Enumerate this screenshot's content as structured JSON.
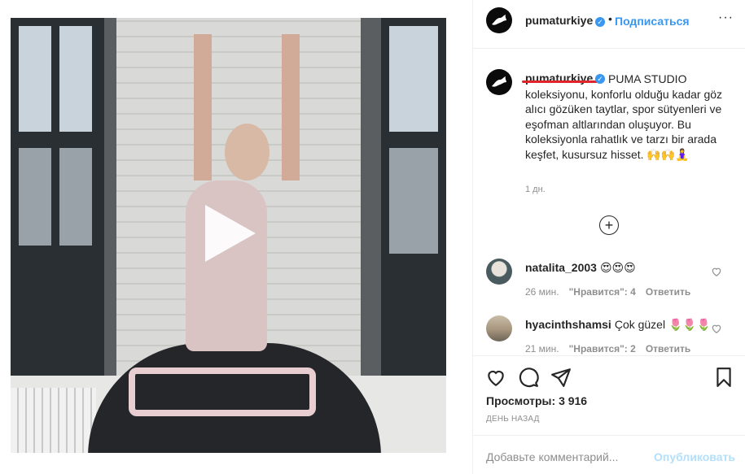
{
  "header": {
    "username": "pumaturkiye",
    "separator": "•",
    "follow_label": "Подписаться",
    "more_label": "···"
  },
  "caption": {
    "username": "pumaturkiye",
    "text": "PUMA STUDIO koleksiyonu, konforlu olduğu kadar göz alıcı gözüken taytlar, spor sütyenleri ve eşofman altlarından oluşuyor. Bu koleksiyonla rahatlık ve tarzı bir arada keşfet, kusursuz hisset. 🙌🙌🧘‍♀️",
    "time": "1 дн.",
    "load_more": "+"
  },
  "comments": [
    {
      "username": "natalita_2003",
      "text": "😍😍😍",
      "time": "26 мин.",
      "likes": "\"Нравится\": 4",
      "reply": "Ответить"
    },
    {
      "username": "hyacinthshamsi",
      "text": "Çok güzel 🌷🌷🌷",
      "time": "21 мин.",
      "likes": "\"Нравится\": 2",
      "reply": "Ответить"
    }
  ],
  "stats": {
    "views_label": "Просмотры:",
    "views_value": "3 916",
    "date": "ДЕНЬ НАЗАД"
  },
  "composer": {
    "placeholder": "Добавьте комментарий...",
    "publish_label": "Опубликовать"
  },
  "colors": {
    "accent": "#3897f0",
    "text": "#262626",
    "muted": "#8e8e8e",
    "highlight": "#e0242b"
  },
  "icons": [
    "puma-logo-icon",
    "verified-icon",
    "more-icon",
    "plus-circle-icon",
    "heart-icon",
    "comment-icon",
    "share-icon",
    "bookmark-icon",
    "play-icon"
  ]
}
